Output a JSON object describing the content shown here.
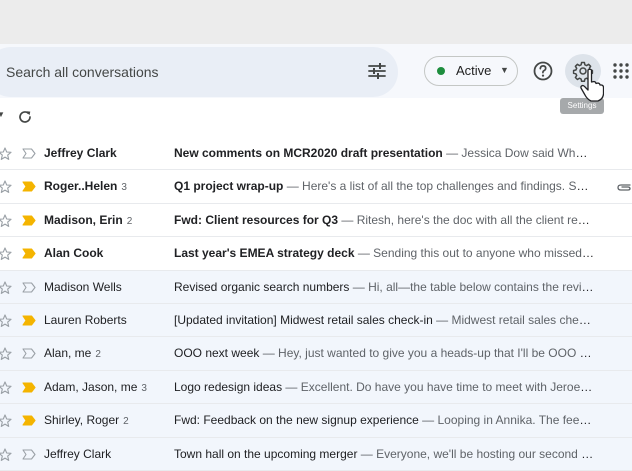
{
  "header": {
    "search_placeholder": "Search all conversations",
    "status_label": "Active",
    "settings_tooltip": "Settings"
  },
  "colors": {
    "accent_blue": "#1a73e8",
    "important_marker": "#f4b400",
    "active_dot": "#1e8e3e"
  },
  "icons": [
    "filter-icon",
    "help-icon",
    "settings-icon",
    "apps-icon",
    "refresh-icon",
    "star-icon",
    "important-marker-icon",
    "attachment-icon"
  ],
  "emails": [
    {
      "sender": "Jeffrey Clark",
      "count": "",
      "subject": "New comments on MCR2020 draft presentation",
      "snippet": " — Jessica Dow said What ab...",
      "important": false,
      "unread": true,
      "attachment": false
    },
    {
      "sender": "Roger..Helen",
      "count": "3",
      "subject": "Q1 project wrap-up",
      "snippet": " — Here's a list of all the top challenges and findings. Surp...",
      "important": true,
      "unread": true,
      "attachment": true
    },
    {
      "sender": "Madison, Erin",
      "count": "2",
      "subject": "Fwd: Client resources for Q3",
      "snippet": " — Ritesh, here's the doc with all the client resour...",
      "important": true,
      "unread": true,
      "attachment": false
    },
    {
      "sender": "Alan Cook",
      "count": "",
      "subject": "Last year's EMEA strategy deck",
      "snippet": " — Sending this out to anyone who missed it...",
      "important": true,
      "unread": true,
      "attachment": false
    },
    {
      "sender": "Madison Wells",
      "count": "",
      "subject": "Revised organic search numbers",
      "snippet": " — Hi, all—the table below contains the revis...",
      "important": false,
      "unread": false,
      "attachment": false
    },
    {
      "sender": "Lauren Roberts",
      "count": "",
      "subject": "[Updated invitation] Midwest retail sales check-in",
      "snippet": " — Midwest retail sales chec...",
      "important": true,
      "unread": false,
      "attachment": false
    },
    {
      "sender": "Alan, me",
      "count": "2",
      "subject": "OOO next week",
      "snippet": " — Hey, just wanted to give you a heads-up that I'll be OOO nex...",
      "important": false,
      "unread": false,
      "attachment": false
    },
    {
      "sender": "Adam, Jason, me",
      "count": "3",
      "subject": "Logo redesign ideas",
      "snippet": " — Excellent. Do have you have time to meet with Jeroen...",
      "important": true,
      "unread": false,
      "attachment": false
    },
    {
      "sender": "Shirley, Roger",
      "count": "2",
      "subject": "Fwd: Feedback on the new signup experience",
      "snippet": " — Looping in Annika. The feedb...",
      "important": true,
      "unread": false,
      "attachment": false
    },
    {
      "sender": "Jeffrey Clark",
      "count": "",
      "subject": "Town hall on the upcoming merger",
      "snippet": " — Everyone, we'll be hosting our second to...",
      "important": false,
      "unread": false,
      "attachment": false
    }
  ]
}
